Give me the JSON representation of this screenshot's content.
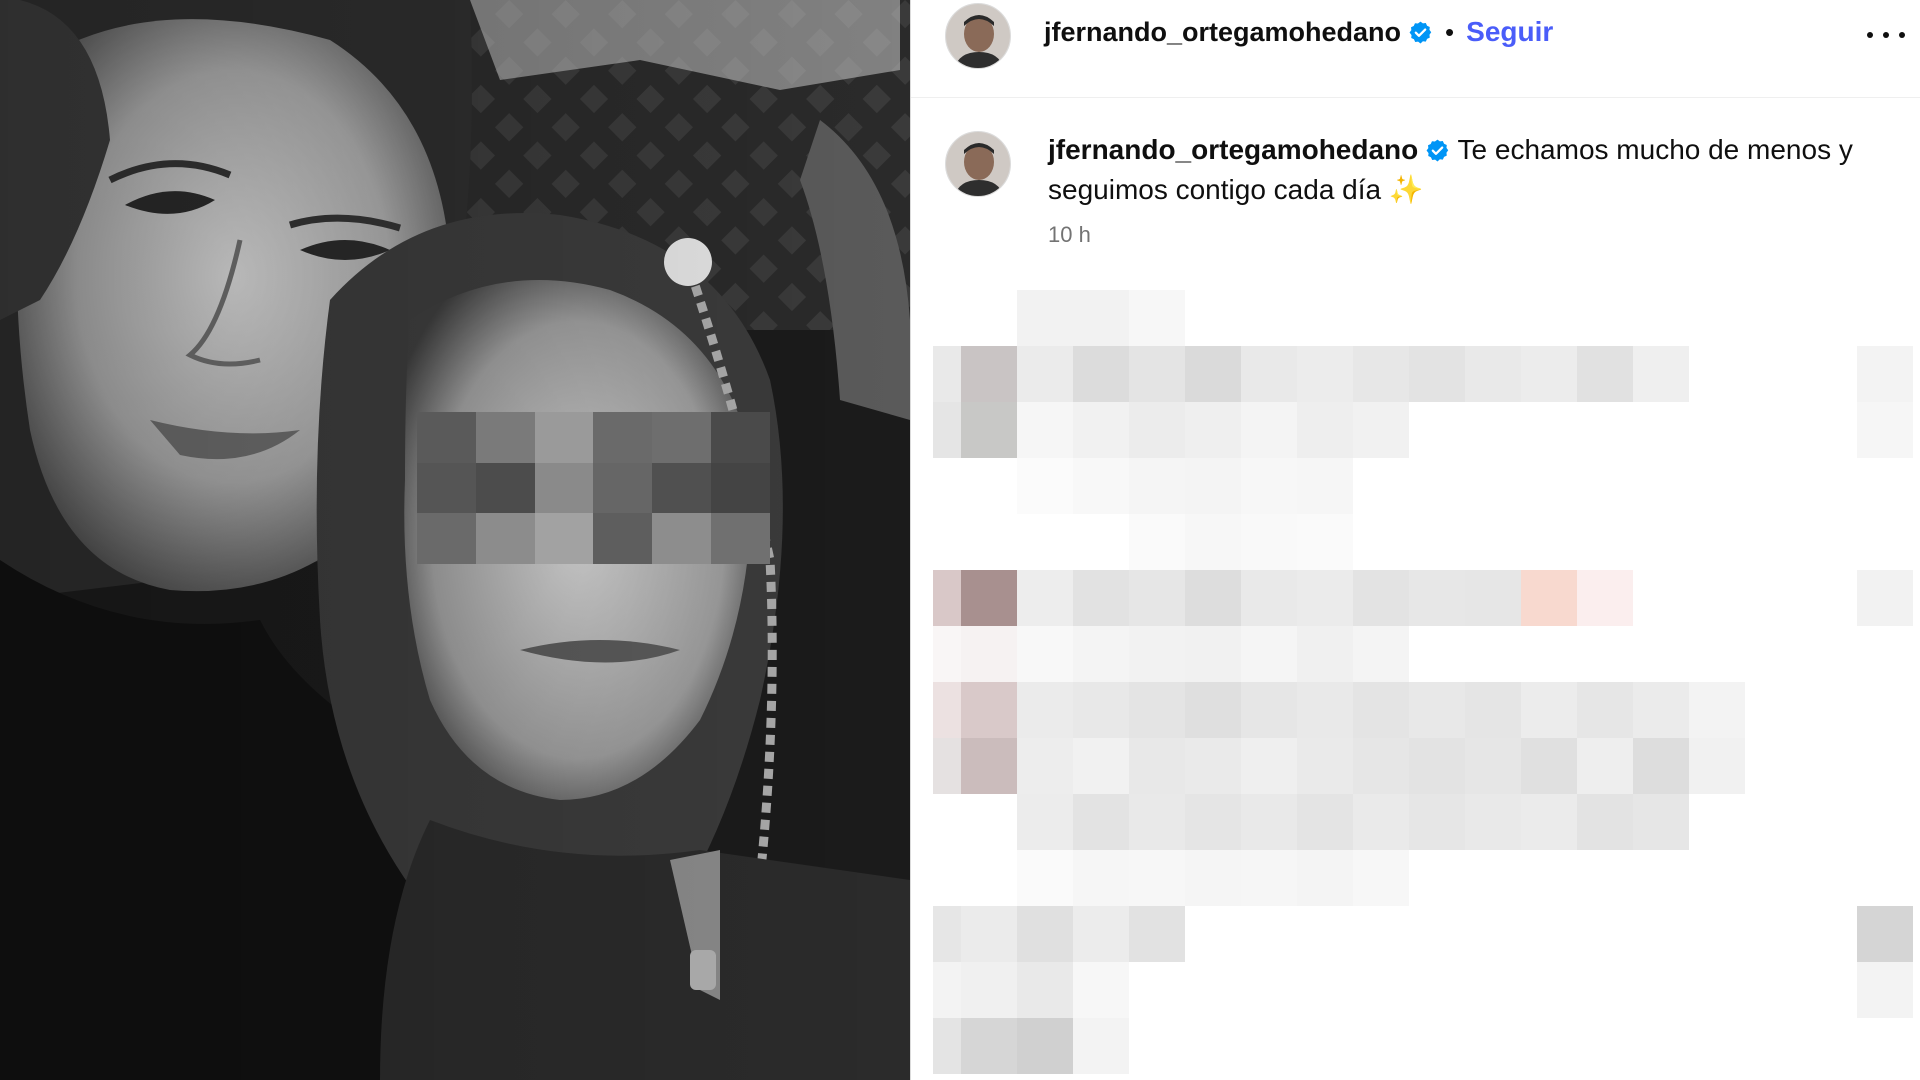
{
  "post": {
    "header": {
      "username": "jfernando_ortegamohedano",
      "separator": "•",
      "follow_label": "Seguir",
      "more_icon": "more-horizontal-icon",
      "verified_icon": "verified-badge-icon"
    },
    "caption": {
      "username": "jfernando_ortegamohedano",
      "text": "Te echamos mucho de menos y seguimos contigo cada día ✨",
      "timestamp": "10 h"
    }
  },
  "colors": {
    "follow_blue": "#4a5df9",
    "verified_blue": "#0095f6",
    "timestamp_gray": "#737373"
  }
}
